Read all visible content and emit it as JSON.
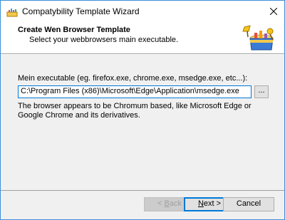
{
  "window": {
    "title": "Compatybility Template Wizard"
  },
  "header": {
    "title": "Create Wen Browser Template",
    "subtitle": "Select your webbrowsers main executable."
  },
  "main": {
    "exe_label": "Mein executable (eg. firefox.exe, chrome.exe, msedge.exe, etc...):",
    "exe_value": "C:\\Program Files (x86)\\Microsoft\\Edge\\Application\\msedge.exe",
    "browse_label": "...",
    "info_text": "The browser appears to be Chromum based, like Microsoft Edge  or Google Chrome and its derivatives."
  },
  "footer": {
    "back_prefix": "< ",
    "back_key": "B",
    "back_rest": "ack",
    "next_key": "N",
    "next_rest": "ext >",
    "cancel_label": "Cancel"
  },
  "colors": {
    "accent": "#0078d7",
    "window_border": "#3c8fd8"
  },
  "icons": [
    "app-icon",
    "close-icon",
    "sandbox-logo-icon"
  ]
}
